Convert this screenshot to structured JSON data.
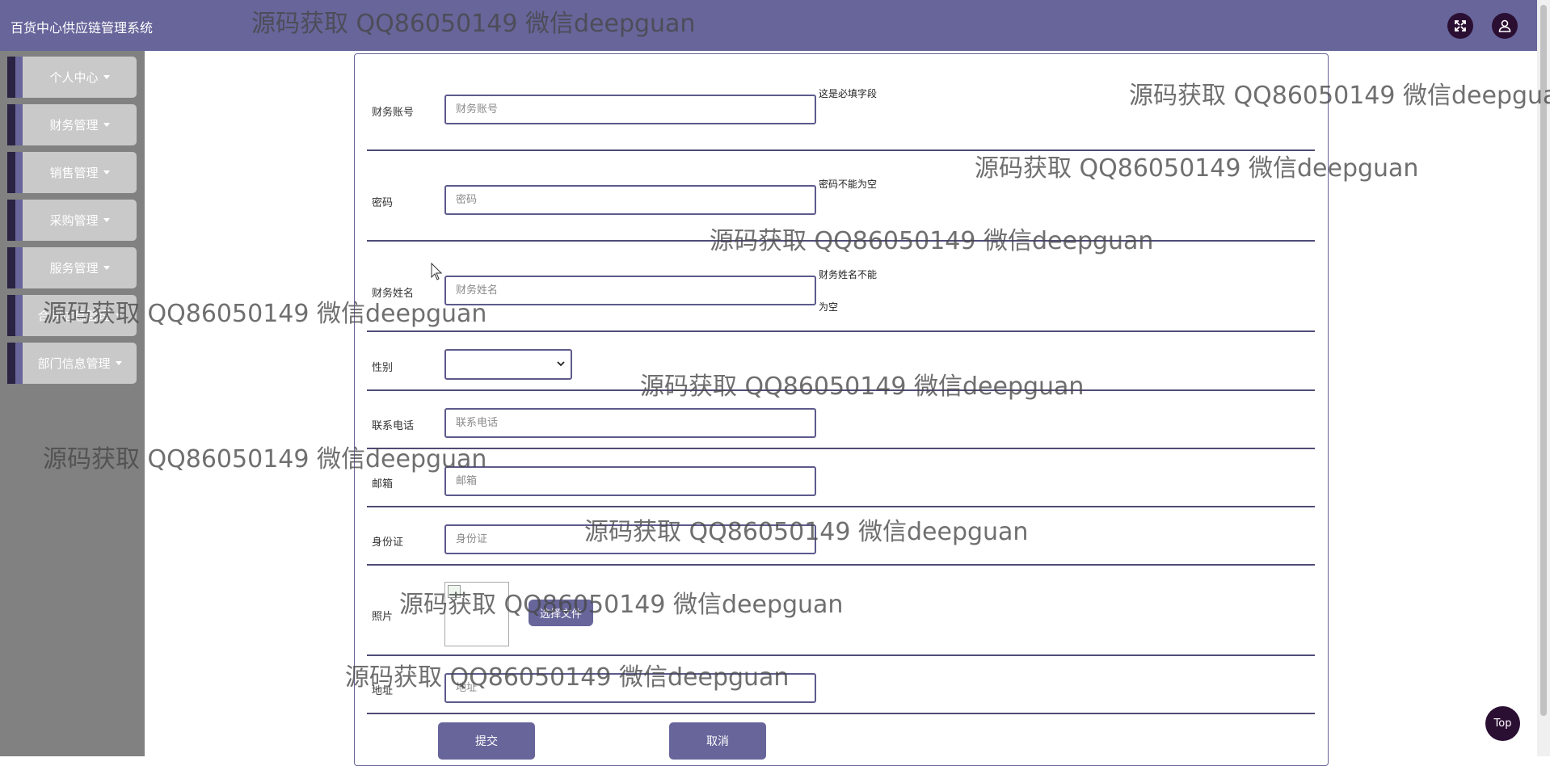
{
  "header": {
    "title": "百货中心供应链管理系统",
    "fullscreen_icon": "expand-icon",
    "user_icon": "user-icon"
  },
  "sidebar": {
    "items": [
      {
        "label": "个人中心"
      },
      {
        "label": "财务管理"
      },
      {
        "label": "销售管理"
      },
      {
        "label": "采购管理"
      },
      {
        "label": "服务管理"
      },
      {
        "label": "合同信息管理"
      },
      {
        "label": "部门信息管理"
      }
    ]
  },
  "form": {
    "account": {
      "label": "财务账号",
      "placeholder": "财务账号",
      "hint": "这是必填字段"
    },
    "password": {
      "label": "密码",
      "placeholder": "密码",
      "hint": "密码不能为空"
    },
    "name": {
      "label": "财务姓名",
      "placeholder": "财务姓名",
      "hint": "财务姓名不能为空"
    },
    "gender": {
      "label": "性别",
      "value": ""
    },
    "phone": {
      "label": "联系电话",
      "placeholder": "联系电话"
    },
    "email": {
      "label": "邮箱",
      "placeholder": "邮箱"
    },
    "idcard": {
      "label": "身份证",
      "placeholder": "身份证"
    },
    "photo": {
      "label": "照片",
      "choose_label": "选择文件"
    },
    "address": {
      "label": "地址",
      "placeholder": "地址"
    },
    "submit_label": "提交",
    "cancel_label": "取消"
  },
  "back_to_top_label": "Top",
  "watermark_text": "源码获取 QQ86050149 微信deepguan"
}
